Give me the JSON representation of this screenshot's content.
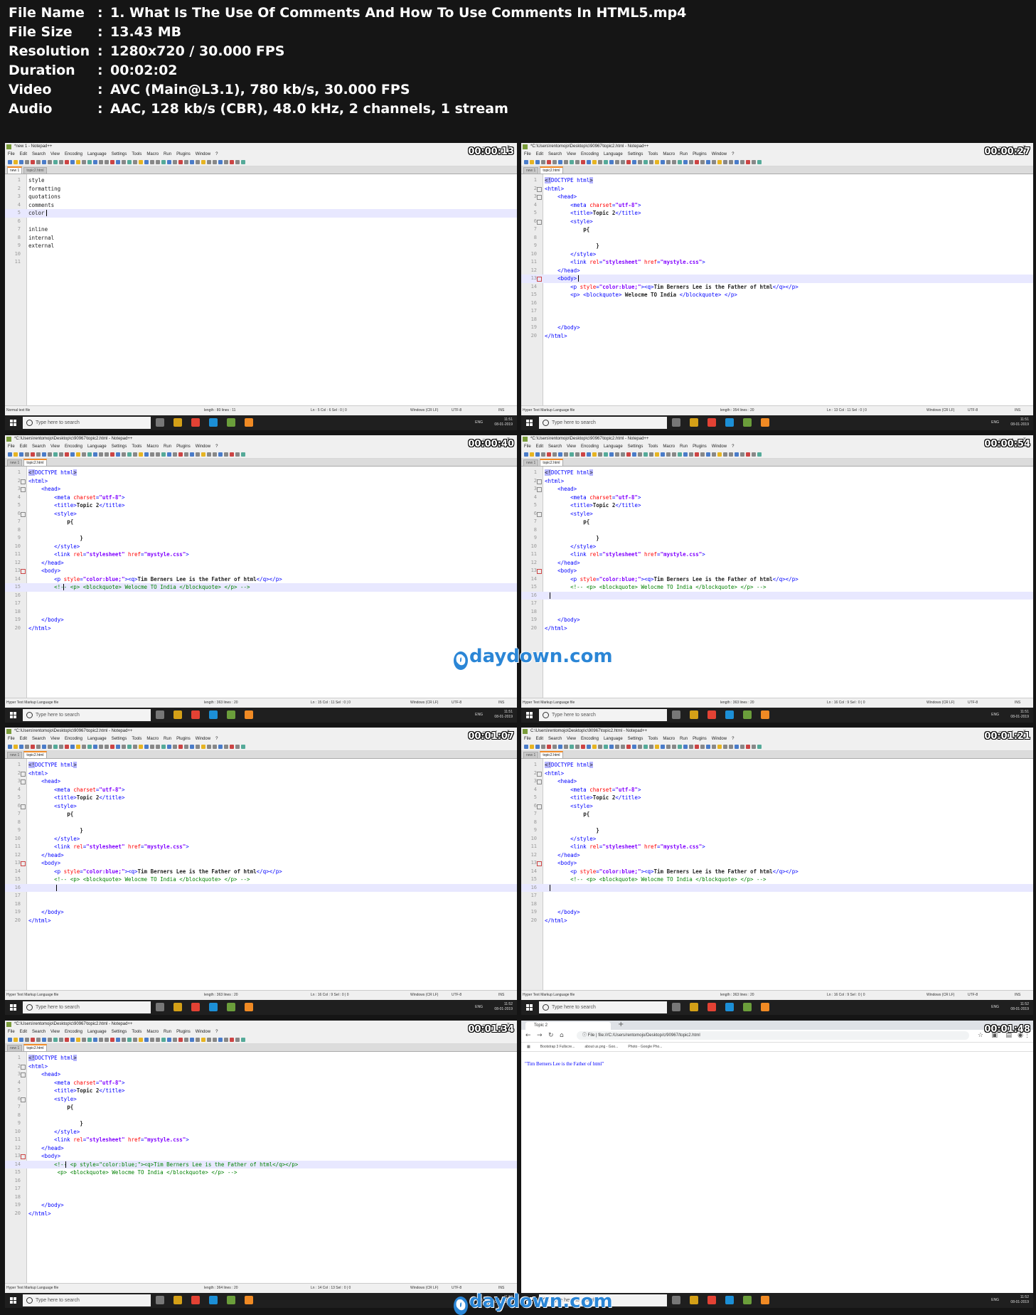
{
  "info": [
    {
      "key": "File Name",
      "value": "1. What Is The Use Of Comments And How To Use Comments In HTML5.mp4"
    },
    {
      "key": "File Size",
      "value": "13.43 MB"
    },
    {
      "key": "Resolution",
      "value": "1280x720 / 30.000 FPS"
    },
    {
      "key": "Duration",
      "value": "00:02:02"
    },
    {
      "key": "Video",
      "value": "AVC (Main@L3.1), 780 kb/s, 30.000 FPS"
    },
    {
      "key": "Audio",
      "value": "AAC, 128 kb/s (CBR), 48.0 kHz, 2 channels, 1 stream"
    }
  ],
  "colon": ":",
  "menu_items": [
    "File",
    "Edit",
    "Search",
    "View",
    "Encoding",
    "Language",
    "Settings",
    "Tools",
    "Macro",
    "Run",
    "Plugins",
    "Window",
    "?"
  ],
  "taskbar_search": "Type here to search",
  "tray_lang": "ENG",
  "tab_new1": "new 1",
  "tab_topic2": "topic2.html",
  "watermark": "daydown.com",
  "frames": [
    {
      "timestamp": "00:00:13",
      "title": "*new 1 - Notepad++",
      "status": {
        "type": "Normal text file",
        "length": "length : 80    lines : 11",
        "pos": "Ln : 5    Col : 6    Sel : 0 | 0",
        "eol": "Windows (CR LF)",
        "enc": "UTF-8",
        "ins": "INS"
      },
      "clock": {
        "time": "11:51",
        "date": "08-01-2019"
      },
      "lines": [
        "style",
        "formatting",
        "quotations",
        "comments",
        "color",
        "",
        "inline",
        "internal",
        "external",
        "",
        ""
      ]
    },
    {
      "timestamp": "00:00:27",
      "title": "*C:\\Users\\rentomojo\\Desktop\\c\\90967\\topic2.html - Notepad++",
      "status": {
        "type": "Hyper Text Markup Language file",
        "length": "length : 354    lines : 20",
        "pos": "Ln : 13    Col : 11    Sel : 0 | 0",
        "eol": "Windows (CR LF)",
        "enc": "UTF-8",
        "ins": "INS"
      },
      "clock": {
        "time": "11:51",
        "date": "08-01-2019"
      }
    },
    {
      "timestamp": "00:00:40",
      "title": "*C:\\Users\\rentomojo\\Desktop\\c\\90967\\topic2.html - Notepad++",
      "status": {
        "type": "Hyper Text Markup Language file",
        "length": "length : 363    lines : 20",
        "pos": "Ln : 15    Col : 11    Sel : 0 | 0",
        "eol": "Windows (CR LF)",
        "enc": "UTF-8",
        "ins": "INS"
      },
      "clock": {
        "time": "11:51",
        "date": "08-01-2019"
      }
    },
    {
      "timestamp": "00:00:54",
      "title": "*C:\\Users\\rentomojo\\Desktop\\c\\90967\\topic2.html - Notepad++",
      "status": {
        "type": "Hyper Text Markup Language file",
        "length": "length : 363    lines : 20",
        "pos": "Ln : 16    Col : 9    Sel : 0 | 0",
        "eol": "Windows (CR LF)",
        "enc": "UTF-8",
        "ins": "INS"
      },
      "clock": {
        "time": "11:51",
        "date": "08-01-2019"
      }
    },
    {
      "timestamp": "00:01:07",
      "title": "*C:\\Users\\rentomojo\\Desktop\\c\\90967\\topic2.html - Notepad++",
      "status": {
        "type": "Hyper Text Markup Language file",
        "length": "length : 363    lines : 20",
        "pos": "Ln : 16    Col : 9    Sel : 0 | 0",
        "eol": "Windows (CR LF)",
        "enc": "UTF-8",
        "ins": "INS"
      },
      "clock": {
        "time": "11:52",
        "date": "08-01-2019"
      }
    },
    {
      "timestamp": "00:01:21",
      "title": "C:\\Users\\rentomojo\\Desktop\\c\\90967\\topic2.html - Notepad++",
      "status": {
        "type": "Hyper Text Markup Language file",
        "length": "length : 363    lines : 20",
        "pos": "Ln : 16    Col : 9    Sel : 0 | 0",
        "eol": "Windows (CR LF)",
        "enc": "UTF-8",
        "ins": "INS"
      },
      "clock": {
        "time": "11:52",
        "date": "08-01-2019"
      }
    },
    {
      "timestamp": "00:01:34",
      "title": "*C:\\Users\\rentomojo\\Desktop\\c\\90967\\topic2.html - Notepad++",
      "status": {
        "type": "Hyper Text Markup Language file",
        "length": "length : 364    lines : 20",
        "pos": "Ln : 14    Col : 13    Sel : 0 | 0",
        "eol": "Windows (CR LF)",
        "enc": "UTF-8",
        "ins": "INS"
      },
      "clock": {
        "time": "11:52",
        "date": "08-01-2019"
      }
    },
    {
      "timestamp": "00:01:48",
      "browser": {
        "tab": "Topic 2",
        "url": "file:///C:/Users/rentomojo/Desktop/c/90967/topic2.html",
        "file_label": "File",
        "bookmarks": [
          "Bootstrap 3 Fullscre...",
          "about us.png - Goo...",
          "Photo - Google Pho..."
        ],
        "page_text": "\"Tim Berners Lee is the Father of html\""
      },
      "clock": {
        "time": "11:52",
        "date": "08-01-2019"
      }
    }
  ]
}
